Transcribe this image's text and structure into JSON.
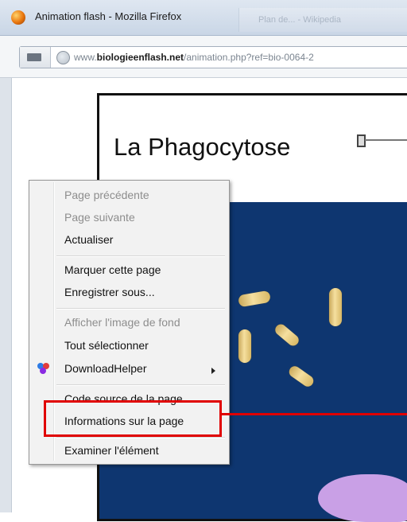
{
  "window": {
    "title": "Animation flash - Mozilla Firefox",
    "ghost_tab": "Plan de... - Wikipedia"
  },
  "addressbar": {
    "prefix": "www.",
    "domain": "biologieenflash.net",
    "path": "/animation.php?ref=bio-0064-2"
  },
  "flash": {
    "title": "La Phagocytose"
  },
  "context_menu": {
    "items": [
      {
        "label": "Page précédente",
        "enabled": false
      },
      {
        "label": "Page suivante",
        "enabled": false
      },
      {
        "label": "Actualiser",
        "enabled": true
      },
      {
        "label": "Marquer cette page",
        "enabled": true
      },
      {
        "label": "Enregistrer sous...",
        "enabled": true
      },
      {
        "label": "Afficher l'image de fond",
        "enabled": false
      },
      {
        "label": "Tout sélectionner",
        "enabled": true
      },
      {
        "label": "DownloadHelper",
        "enabled": true,
        "submenu": true
      },
      {
        "label": "Code source de la page",
        "enabled": true
      },
      {
        "label": "Informations sur la page",
        "enabled": true,
        "highlighted": true
      },
      {
        "label": "Examiner l'élément",
        "enabled": true
      }
    ]
  },
  "colors": {
    "highlight": "#e00000",
    "flash_background": "#0e3670",
    "bacteria": "#f0d48a"
  }
}
